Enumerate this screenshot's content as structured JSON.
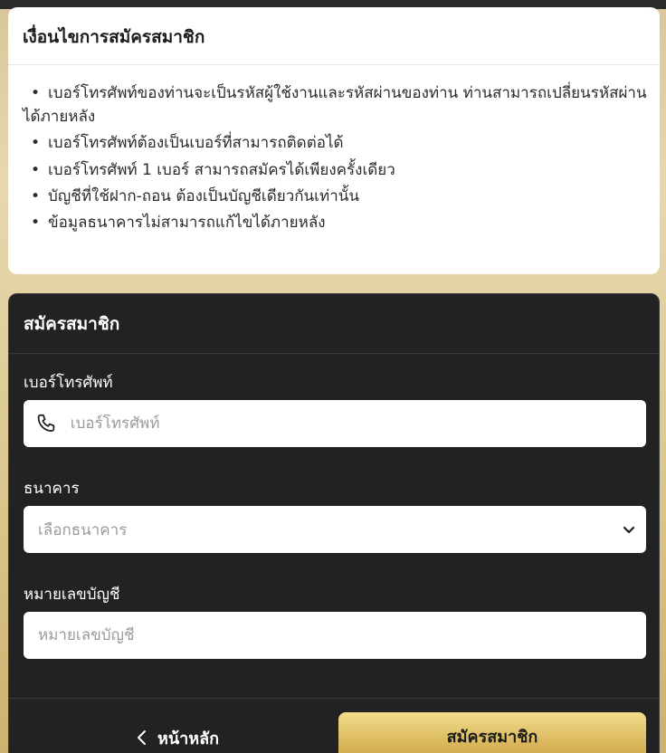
{
  "terms": {
    "title": "เงื่อนไขการสมัครสมาชิก",
    "bullet": "•",
    "items": [
      "เบอร์โทรศัพท์ของท่านจะเป็นรหัสผู้ใช้งานและรหัสผ่านของท่าน ท่านสามารถเปลี่ยนรหัสผ่านได้ภายหลัง",
      "เบอร์โทรศัพท์ต้องเป็นเบอร์ที่สามารถติดต่อได้",
      "เบอร์โทรศัพท์ 1 เบอร์ สามารถสมัครได้เพียงครั้งเดียว",
      "บัญชีที่ใช้ฝาก-ถอน ต้องเป็นบัญชีเดียวกันเท่านั้น",
      "ข้อมูลธนาคารไม่สามารถแก้ไขได้ภายหลัง"
    ]
  },
  "form": {
    "title": "สมัครสมาชิก",
    "phone": {
      "label": "เบอร์โทรศัพท์",
      "placeholder": "เบอร์โทรศัพท์",
      "value": "",
      "icon": "phone-icon"
    },
    "bank": {
      "label": "ธนาคาร",
      "placeholder": "เลือกธนาคาร",
      "icon": "chevron-down-icon"
    },
    "account": {
      "label": "หมายเลขบัญชี",
      "placeholder": "หมายเลขบัญชี",
      "value": ""
    },
    "back_label": "หน้าหลัก",
    "back_icon": "chevron-left-icon",
    "submit_label": "สมัครสมาชิก"
  },
  "colors": {
    "accent_gold": "#d9b65a",
    "panel_dark": "#232222",
    "page_bg": "#dcc991"
  }
}
